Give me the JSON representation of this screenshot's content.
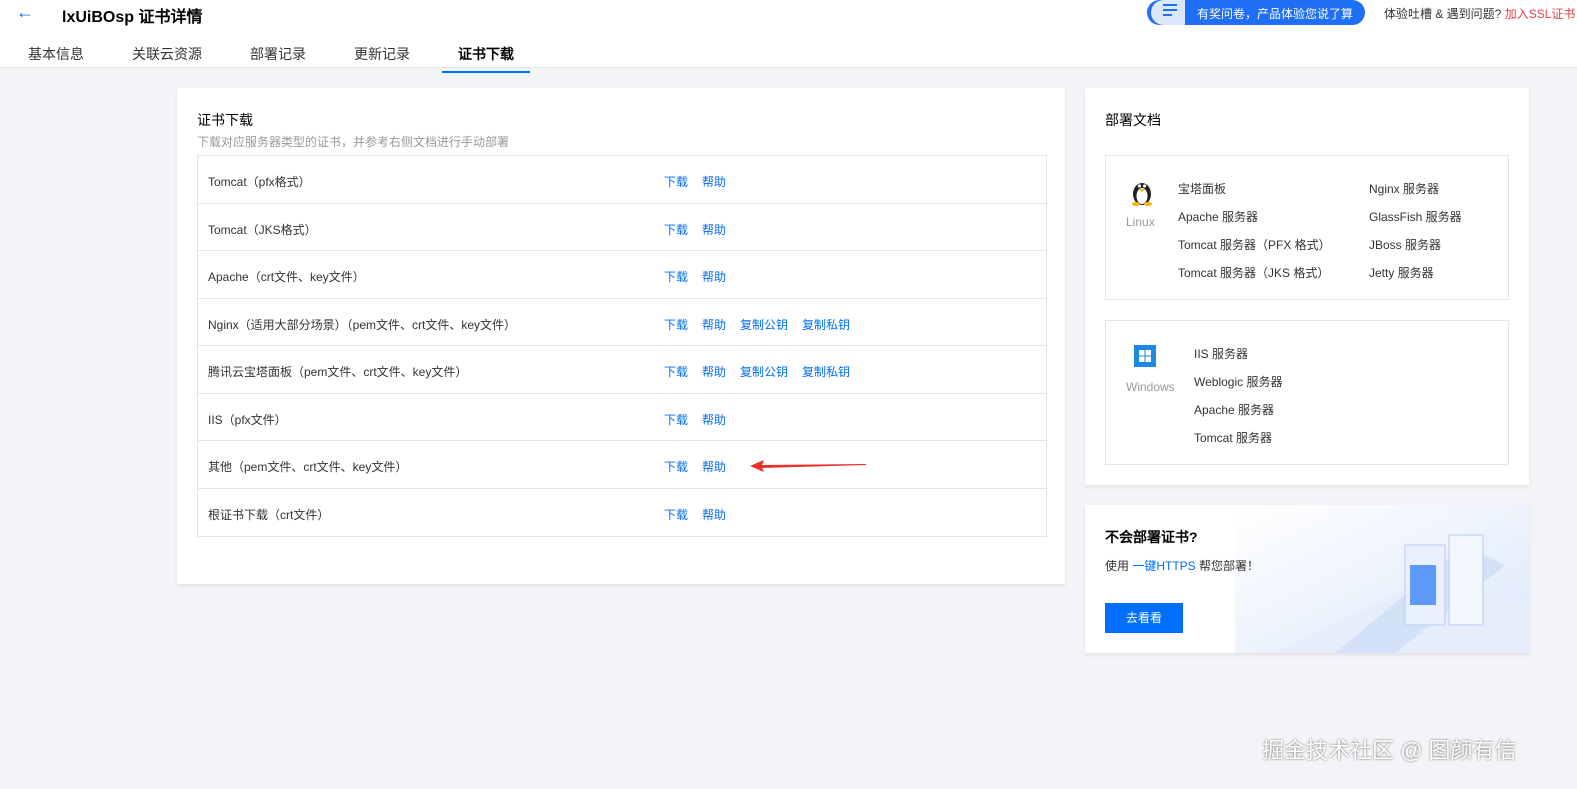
{
  "header": {
    "back_icon": "arrow-left-icon",
    "title": "lxUiBOsp 证书详情",
    "tabs": [
      {
        "label": "基本信息",
        "active": false
      },
      {
        "label": "关联云资源",
        "active": false
      },
      {
        "label": "部署记录",
        "active": false
      },
      {
        "label": "更新记录",
        "active": false
      },
      {
        "label": "证书下载",
        "active": true
      }
    ],
    "survey_label": "有奖问卷，产品体验您说了算",
    "feedback_text": "体验吐槽 & 遇到问题?",
    "feedback_link": "加入SSL证书"
  },
  "download": {
    "title": "证书下载",
    "subtitle": "下载对应服务器类型的证书，并参考右侧文档进行手动部署",
    "rows": [
      {
        "label": "Tomcat（pfx格式）",
        "actions": [
          "下载",
          "帮助"
        ]
      },
      {
        "label": "Tomcat（JKS格式）",
        "actions": [
          "下载",
          "帮助"
        ]
      },
      {
        "label": "Apache（crt文件、key文件）",
        "actions": [
          "下载",
          "帮助"
        ]
      },
      {
        "label": "Nginx（适用大部分场景）（pem文件、crt文件、key文件）",
        "actions": [
          "下载",
          "帮助",
          "复制公钥",
          "复制私钥"
        ]
      },
      {
        "label": "腾讯云宝塔面板（pem文件、crt文件、key文件）",
        "actions": [
          "下载",
          "帮助",
          "复制公钥",
          "复制私钥"
        ]
      },
      {
        "label": "IIS（pfx文件）",
        "actions": [
          "下载",
          "帮助"
        ]
      },
      {
        "label": "其他（pem文件、crt文件、key文件）",
        "actions": [
          "下载",
          "帮助"
        ]
      },
      {
        "label": "根证书下载（crt文件）",
        "actions": [
          "下载",
          "帮助"
        ]
      }
    ]
  },
  "docs": {
    "title": "部署文档",
    "linux": {
      "name": "Linux",
      "icon": "linux-penguin-icon",
      "col1": [
        "宝塔面板",
        "Apache 服务器",
        "Tomcat 服务器（PFX 格式）",
        "Tomcat 服务器（JKS 格式）"
      ],
      "col2": [
        "Nginx 服务器",
        "GlassFish 服务器",
        "JBoss 服务器",
        "Jetty 服务器"
      ]
    },
    "windows": {
      "name": "Windows",
      "icon": "windows-logo-icon",
      "items": [
        "IIS 服务器",
        "Weblogic 服务器",
        "Apache 服务器",
        "Tomcat 服务器"
      ]
    }
  },
  "tip": {
    "title": "不会部署证书?",
    "text_prefix": "使用 ",
    "link": "一键HTTPS",
    "text_suffix": " 帮您部署！",
    "button": "去看看"
  },
  "watermark": "掘金技术社区 @ 图颜有信",
  "colors": {
    "accent": "#006eff",
    "arrow": "#e8302c",
    "feedback_link": "#e54545"
  }
}
